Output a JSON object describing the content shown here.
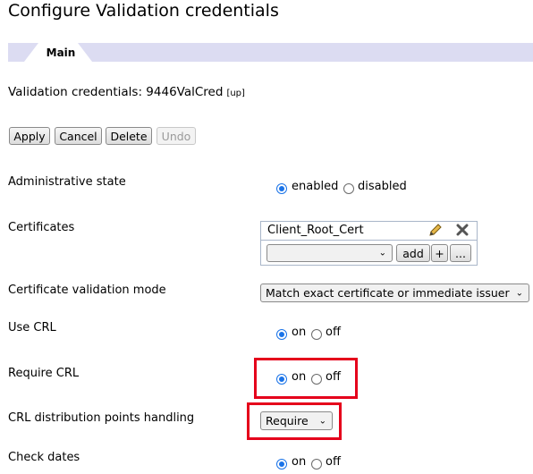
{
  "page": {
    "title": "Configure Validation credentials"
  },
  "tabs": [
    {
      "label": "Main"
    }
  ],
  "object": {
    "title": "Validation credentials: 9446ValCred",
    "up_link": "[up]"
  },
  "toolbar": {
    "apply": "Apply",
    "cancel": "Cancel",
    "delete": "Delete",
    "undo": "Undo"
  },
  "fields": {
    "admin_state": {
      "label": "Administrative state",
      "options": [
        "enabled",
        "disabled"
      ],
      "selected": "enabled"
    },
    "certificates": {
      "label": "Certificates",
      "items": [
        "Client_Root_Cert"
      ],
      "add_label": "add",
      "plus_label": "+",
      "more_label": "..."
    },
    "cert_validation_mode": {
      "label": "Certificate validation mode",
      "value": "Match exact certificate or immediate issuer"
    },
    "use_crl": {
      "label": "Use CRL",
      "options": [
        "on",
        "off"
      ],
      "selected": "on"
    },
    "require_crl": {
      "label": "Require CRL",
      "options": [
        "on",
        "off"
      ],
      "selected": "on"
    },
    "crl_dp_handling": {
      "label": "CRL distribution points handling",
      "value": "Require"
    },
    "check_dates": {
      "label": "Check dates",
      "options": [
        "on",
        "off"
      ],
      "selected": "on"
    }
  },
  "colors": {
    "tab_strip": "#dcdcf2",
    "radio_selected": "#1a73e8",
    "highlight_box": "#e5001b"
  }
}
